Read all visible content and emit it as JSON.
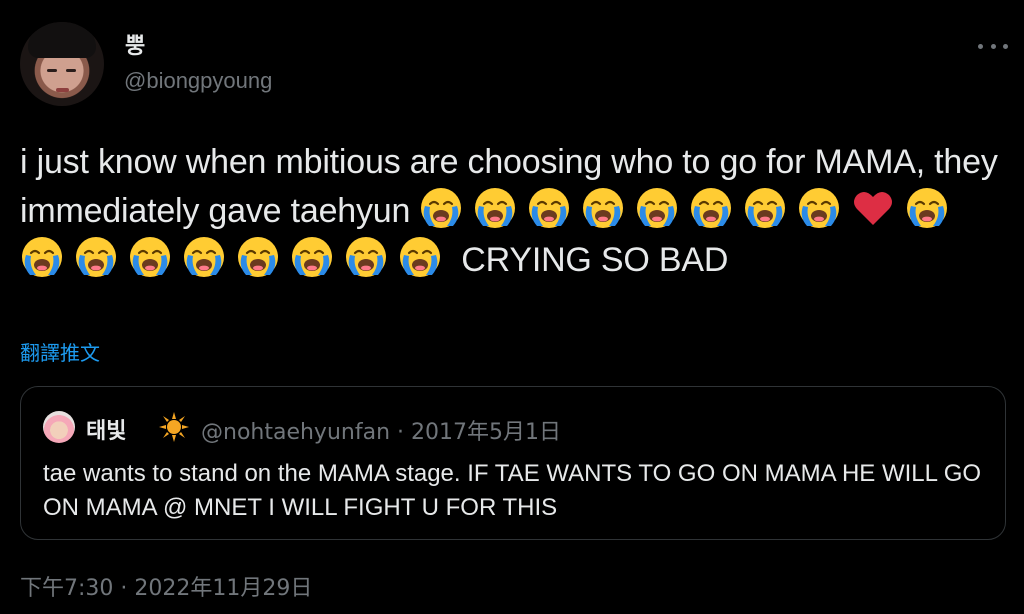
{
  "tweet": {
    "display_name": "뿡",
    "handle": "@biongpyoung",
    "text_part1": "i just know when mbitious are choosing who to go for MAMA, they immediately gave taehyun",
    "text_part2": "CRYING SO BAD",
    "emoji_sequence": [
      "loudly-crying",
      "loudly-crying",
      "loudly-crying",
      "loudly-crying",
      "loudly-crying",
      "loudly-crying",
      "loudly-crying",
      "loudly-crying",
      "red-heart",
      "loudly-crying",
      "loudly-crying",
      "loudly-crying",
      "loudly-crying",
      "loudly-crying",
      "loudly-crying",
      "loudly-crying",
      "loudly-crying",
      "loudly-crying"
    ],
    "translate_label": "翻譯推文",
    "timestamp": "下午7:30 · 2022年11月29日"
  },
  "quoted_tweet": {
    "display_name": "태빛",
    "name_icon": "sun-icon",
    "meta": "@nohtaehyunfan · 2017年5月1日",
    "text": "tae wants to stand on the MAMA stage. IF TAE WANTS TO GO ON MAMA HE WILL GO ON MAMA @ MNET I WILL FIGHT U FOR THIS"
  },
  "icons": {
    "more": "more-horizontal-icon"
  },
  "colors": {
    "background": "#000000",
    "text": "#e7e9ea",
    "secondary": "#71767b",
    "link": "#1d9bf0",
    "border": "#2f3336"
  }
}
